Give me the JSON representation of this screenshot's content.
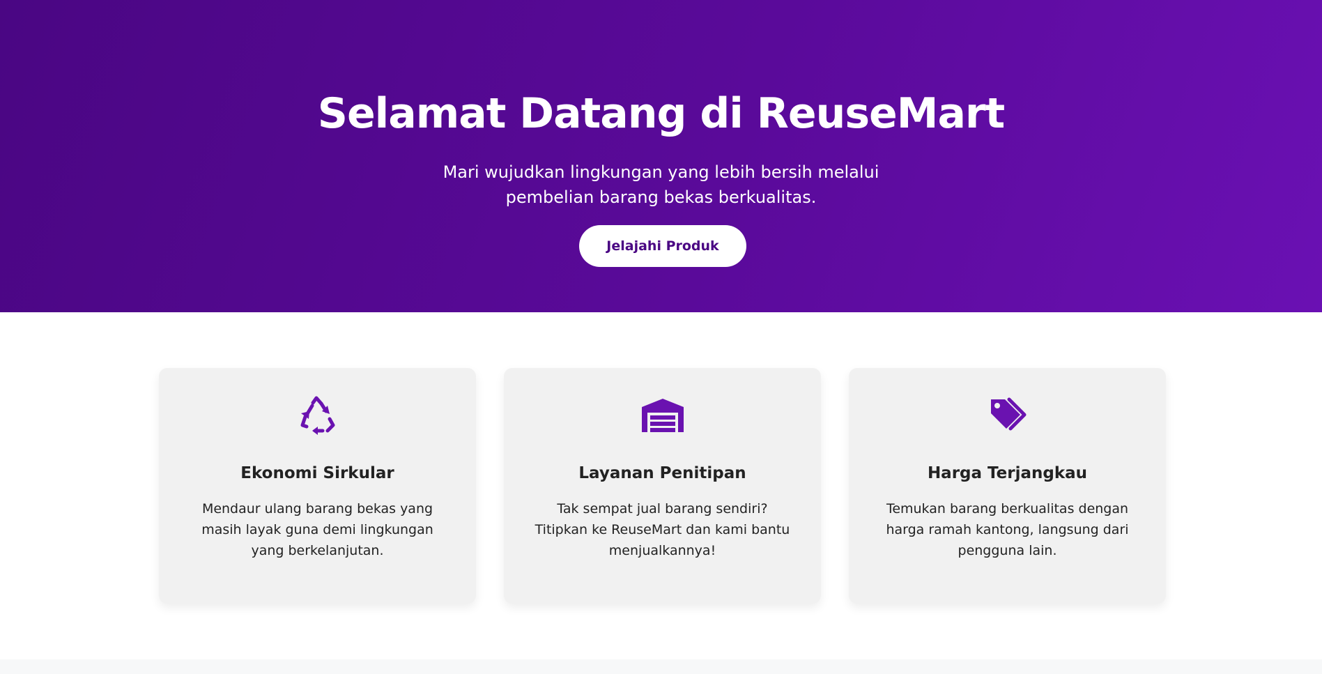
{
  "hero": {
    "title": "Selamat Datang di ReuseMart",
    "subtitle": "Mari wujudkan lingkungan yang lebih bersih melalui pembelian barang bekas berkualitas.",
    "cta_label": "Jelajahi Produk"
  },
  "features": [
    {
      "icon": "recycle-icon",
      "title": "Ekonomi Sirkular",
      "text": "Mendaur ulang barang bekas yang masih layak guna demi lingkungan yang berkelanjutan."
    },
    {
      "icon": "warehouse-icon",
      "title": "Layanan Penitipan",
      "text": "Tak sempat jual barang sendiri? Titipkan ke ReuseMart dan kami bantu menjualkannya!"
    },
    {
      "icon": "tags-icon",
      "title": "Harga Terjangkau",
      "text": "Temukan barang berkualitas dengan harga ramah kantong, langsung dari pengguna lain."
    }
  ],
  "colors": {
    "brand_purple": "#5a0a9a",
    "icon_purple": "#6a12b0",
    "card_bg": "#f1f1f1"
  }
}
